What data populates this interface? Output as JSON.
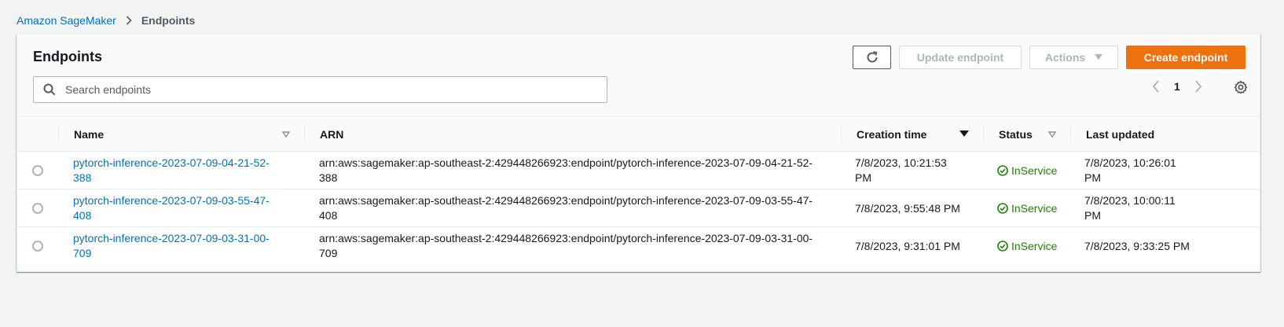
{
  "breadcrumb": {
    "root": "Amazon SageMaker",
    "current": "Endpoints"
  },
  "panel": {
    "title": "Endpoints",
    "refresh_icon": "refresh-icon",
    "update_label": "Update endpoint",
    "actions_label": "Actions",
    "create_label": "Create endpoint"
  },
  "search": {
    "placeholder": "Search endpoints",
    "value": ""
  },
  "pagination": {
    "page": "1"
  },
  "table": {
    "columns": {
      "name": "Name",
      "arn": "ARN",
      "creation_time": "Creation time",
      "status": "Status",
      "last_updated": "Last updated"
    },
    "rows": [
      {
        "name_line1": "pytorch-inference-2023-07-09-04-21-52-",
        "name_line2": "388",
        "arn_line1": "arn:aws:sagemaker:ap-southeast-2:429448266923:endpoint/pytorch-inference-2023-07-09-04-21-52-",
        "arn_line2": "388",
        "creation_line1": "7/8/2023, 10:21:53",
        "creation_line2": "PM",
        "status": "InService",
        "updated_line1": "7/8/2023, 10:26:01",
        "updated_line2": "PM"
      },
      {
        "name_line1": "pytorch-inference-2023-07-09-03-55-47-",
        "name_line2": "408",
        "arn_line1": "arn:aws:sagemaker:ap-southeast-2:429448266923:endpoint/pytorch-inference-2023-07-09-03-55-47-",
        "arn_line2": "408",
        "creation_line1": "7/8/2023, 9:55:48 PM",
        "creation_line2": "",
        "status": "InService",
        "updated_line1": "7/8/2023, 10:00:11",
        "updated_line2": "PM"
      },
      {
        "name_line1": "pytorch-inference-2023-07-09-03-31-00-",
        "name_line2": "709",
        "arn_line1": "arn:aws:sagemaker:ap-southeast-2:429448266923:endpoint/pytorch-inference-2023-07-09-03-31-00-",
        "arn_line2": "709",
        "creation_line1": "7/8/2023, 9:31:01 PM",
        "creation_line2": "",
        "status": "InService",
        "updated_line1": "7/8/2023, 9:33:25 PM",
        "updated_line2": ""
      }
    ]
  },
  "colors": {
    "link": "#0073bb",
    "primary": "#ec7211",
    "success": "#1d8102"
  }
}
